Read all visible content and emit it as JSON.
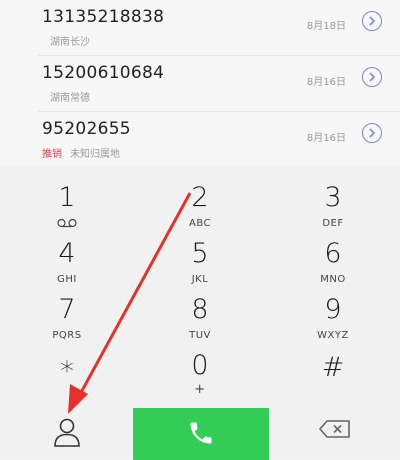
{
  "recent_calls": [
    {
      "number": "13135218838",
      "tag": "",
      "location": "湖南长沙",
      "date": "8月18日"
    },
    {
      "number": "15200610684",
      "tag": "",
      "location": "湖南常德",
      "date": "8月16日"
    },
    {
      "number": "95202655",
      "tag": "推销",
      "location": "未知归属地",
      "date": "8月16日"
    }
  ],
  "keypad": [
    {
      "digit": "1",
      "letters": ""
    },
    {
      "digit": "2",
      "letters": "ABC"
    },
    {
      "digit": "3",
      "letters": "DEF"
    },
    {
      "digit": "4",
      "letters": "GHI"
    },
    {
      "digit": "5",
      "letters": "JKL"
    },
    {
      "digit": "6",
      "letters": "MNO"
    },
    {
      "digit": "7",
      "letters": "PQRS"
    },
    {
      "digit": "8",
      "letters": "TUV"
    },
    {
      "digit": "9",
      "letters": "WXYZ"
    },
    {
      "digit": "*",
      "letters": ""
    },
    {
      "digit": "0",
      "letters": "+"
    },
    {
      "digit": "#",
      "letters": ""
    }
  ],
  "icons": {
    "voicemail": "voicemail-icon",
    "contacts": "person-icon",
    "call": "phone-icon",
    "delete": "backspace-icon",
    "info": "chevron-right-icon"
  },
  "colors": {
    "call_button": "#33cc55",
    "tag_red": "#e0435a",
    "info_ring": "#7b86d6",
    "annotation_arrow": "#e8302a"
  }
}
